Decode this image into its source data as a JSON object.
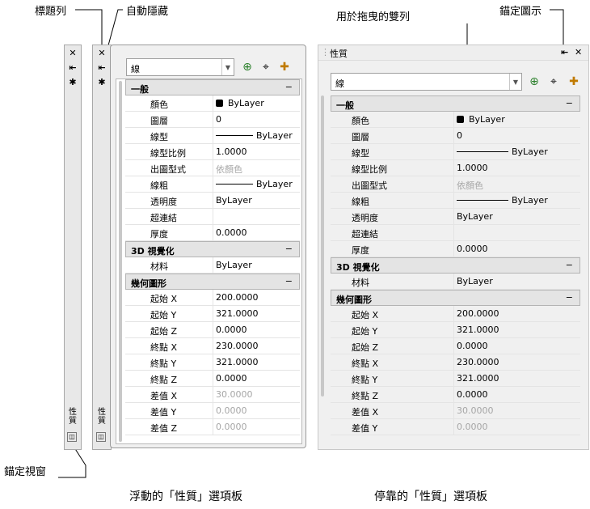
{
  "callouts": {
    "title_bar": "標題列",
    "auto_hide": "自動隱藏",
    "drag_bar": "用於拖曳的雙列",
    "anchor_icon": "錨定圖示",
    "anchor_window": "錨定視窗"
  },
  "captions": {
    "floating": "浮動的「性質」選項板",
    "docked": "停靠的「性質」選項板"
  },
  "floating": {
    "vertical_tab": "性質",
    "dropdown_value": "線",
    "icons": [
      "close-icon",
      "auto-hide-icon",
      "settings-icon",
      "quick-select-icon",
      "select-objects-icon",
      "pickadd-icon"
    ],
    "categories": [
      {
        "title": "一般",
        "collapse": "−",
        "rows": [
          {
            "name": "顏色",
            "value": "ByLayer",
            "kind": "swatch"
          },
          {
            "name": "圖層",
            "value": "0"
          },
          {
            "name": "線型",
            "value": "ByLayer",
            "kind": "line"
          },
          {
            "name": "線型比例",
            "value": "1.0000"
          },
          {
            "name": "出圖型式",
            "value": "依顏色",
            "gray": true
          },
          {
            "name": "線粗",
            "value": "ByLayer",
            "kind": "line"
          },
          {
            "name": "透明度",
            "value": "ByLayer"
          },
          {
            "name": "超連結",
            "value": ""
          },
          {
            "name": "厚度",
            "value": "0.0000"
          }
        ]
      },
      {
        "title": "3D 視覺化",
        "collapse": "−",
        "rows": [
          {
            "name": "材料",
            "value": "ByLayer"
          }
        ]
      },
      {
        "title": "幾何圖形",
        "collapse": "−",
        "rows": [
          {
            "name": "起始 X",
            "value": "200.0000"
          },
          {
            "name": "起始 Y",
            "value": "321.0000"
          },
          {
            "name": "起始 Z",
            "value": "0.0000"
          },
          {
            "name": "終點 X",
            "value": "230.0000"
          },
          {
            "name": "終點 Y",
            "value": "321.0000"
          },
          {
            "name": "終點 Z",
            "value": "0.0000"
          },
          {
            "name": "差值 X",
            "value": "30.0000",
            "gray": true
          },
          {
            "name": "差值 Y",
            "value": "0.0000",
            "gray": true
          },
          {
            "name": "差值 Z",
            "value": "0.0000",
            "gray": true
          }
        ]
      }
    ]
  },
  "docked": {
    "title": "性質",
    "dropdown_value": "線",
    "categories": [
      {
        "title": "一般",
        "collapse": "−",
        "rows": [
          {
            "name": "顏色",
            "value": "ByLayer",
            "kind": "swatch"
          },
          {
            "name": "圖層",
            "value": "0"
          },
          {
            "name": "線型",
            "value": "ByLayer",
            "kind": "line"
          },
          {
            "name": "線型比例",
            "value": "1.0000"
          },
          {
            "name": "出圖型式",
            "value": "依顏色",
            "gray": true
          },
          {
            "name": "線粗",
            "value": "ByLayer",
            "kind": "line"
          },
          {
            "name": "透明度",
            "value": "ByLayer"
          },
          {
            "name": "超連結",
            "value": ""
          },
          {
            "name": "厚度",
            "value": "0.0000"
          }
        ]
      },
      {
        "title": "3D 視覺化",
        "collapse": "−",
        "rows": [
          {
            "name": "材料",
            "value": "ByLayer"
          }
        ]
      },
      {
        "title": "幾何圖形",
        "collapse": "−",
        "rows": [
          {
            "name": "起始 X",
            "value": "200.0000"
          },
          {
            "name": "起始 Y",
            "value": "321.0000"
          },
          {
            "name": "起始 Z",
            "value": "0.0000"
          },
          {
            "name": "終點 X",
            "value": "230.0000"
          },
          {
            "name": "終點 Y",
            "value": "321.0000"
          },
          {
            "name": "終點 Z",
            "value": "0.0000"
          },
          {
            "name": "差值 X",
            "value": "30.0000",
            "gray": true
          },
          {
            "name": "差值 Y",
            "value": "0.0000",
            "gray": true
          }
        ]
      }
    ]
  },
  "glyphs": {
    "close": "✕",
    "auto_hide": "⇤",
    "settings": "✱",
    "dropdown_arrow": "▼",
    "quick_select": "⊕",
    "select_objects": "⌖",
    "pickadd": "✚",
    "anchor": "◫",
    "grip": "⋮"
  }
}
